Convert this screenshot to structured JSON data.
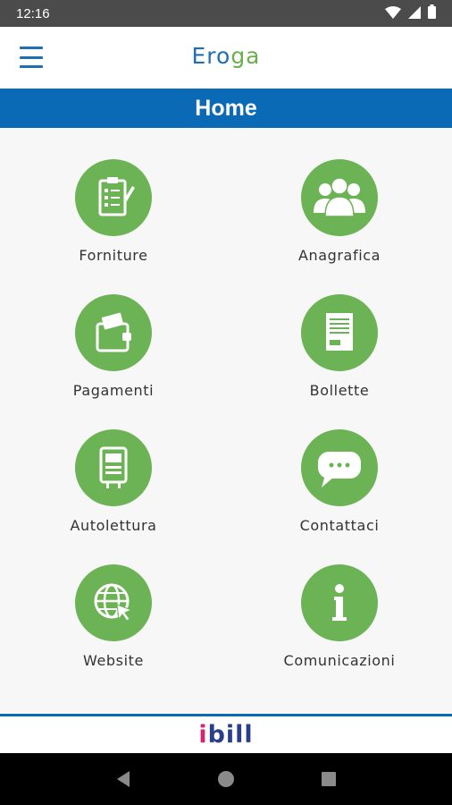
{
  "status_bar": {
    "time": "12:16"
  },
  "header": {
    "logo_part1": "Ero",
    "logo_part2": "ga"
  },
  "title_bar": {
    "title": "Home"
  },
  "menu": [
    {
      "label": "Forniture"
    },
    {
      "label": "Anagrafica"
    },
    {
      "label": "Pagamenti"
    },
    {
      "label": "Bollette"
    },
    {
      "label": "Autolettura"
    },
    {
      "label": "Contattaci"
    },
    {
      "label": "Website"
    },
    {
      "label": "Comunicazioni"
    }
  ],
  "footer": {
    "brand_part1": "i",
    "brand_part2": "bill"
  },
  "colors": {
    "primary_blue": "#0a6ab5",
    "tile_green": "#6cb355",
    "brand_pink": "#d6246e"
  }
}
